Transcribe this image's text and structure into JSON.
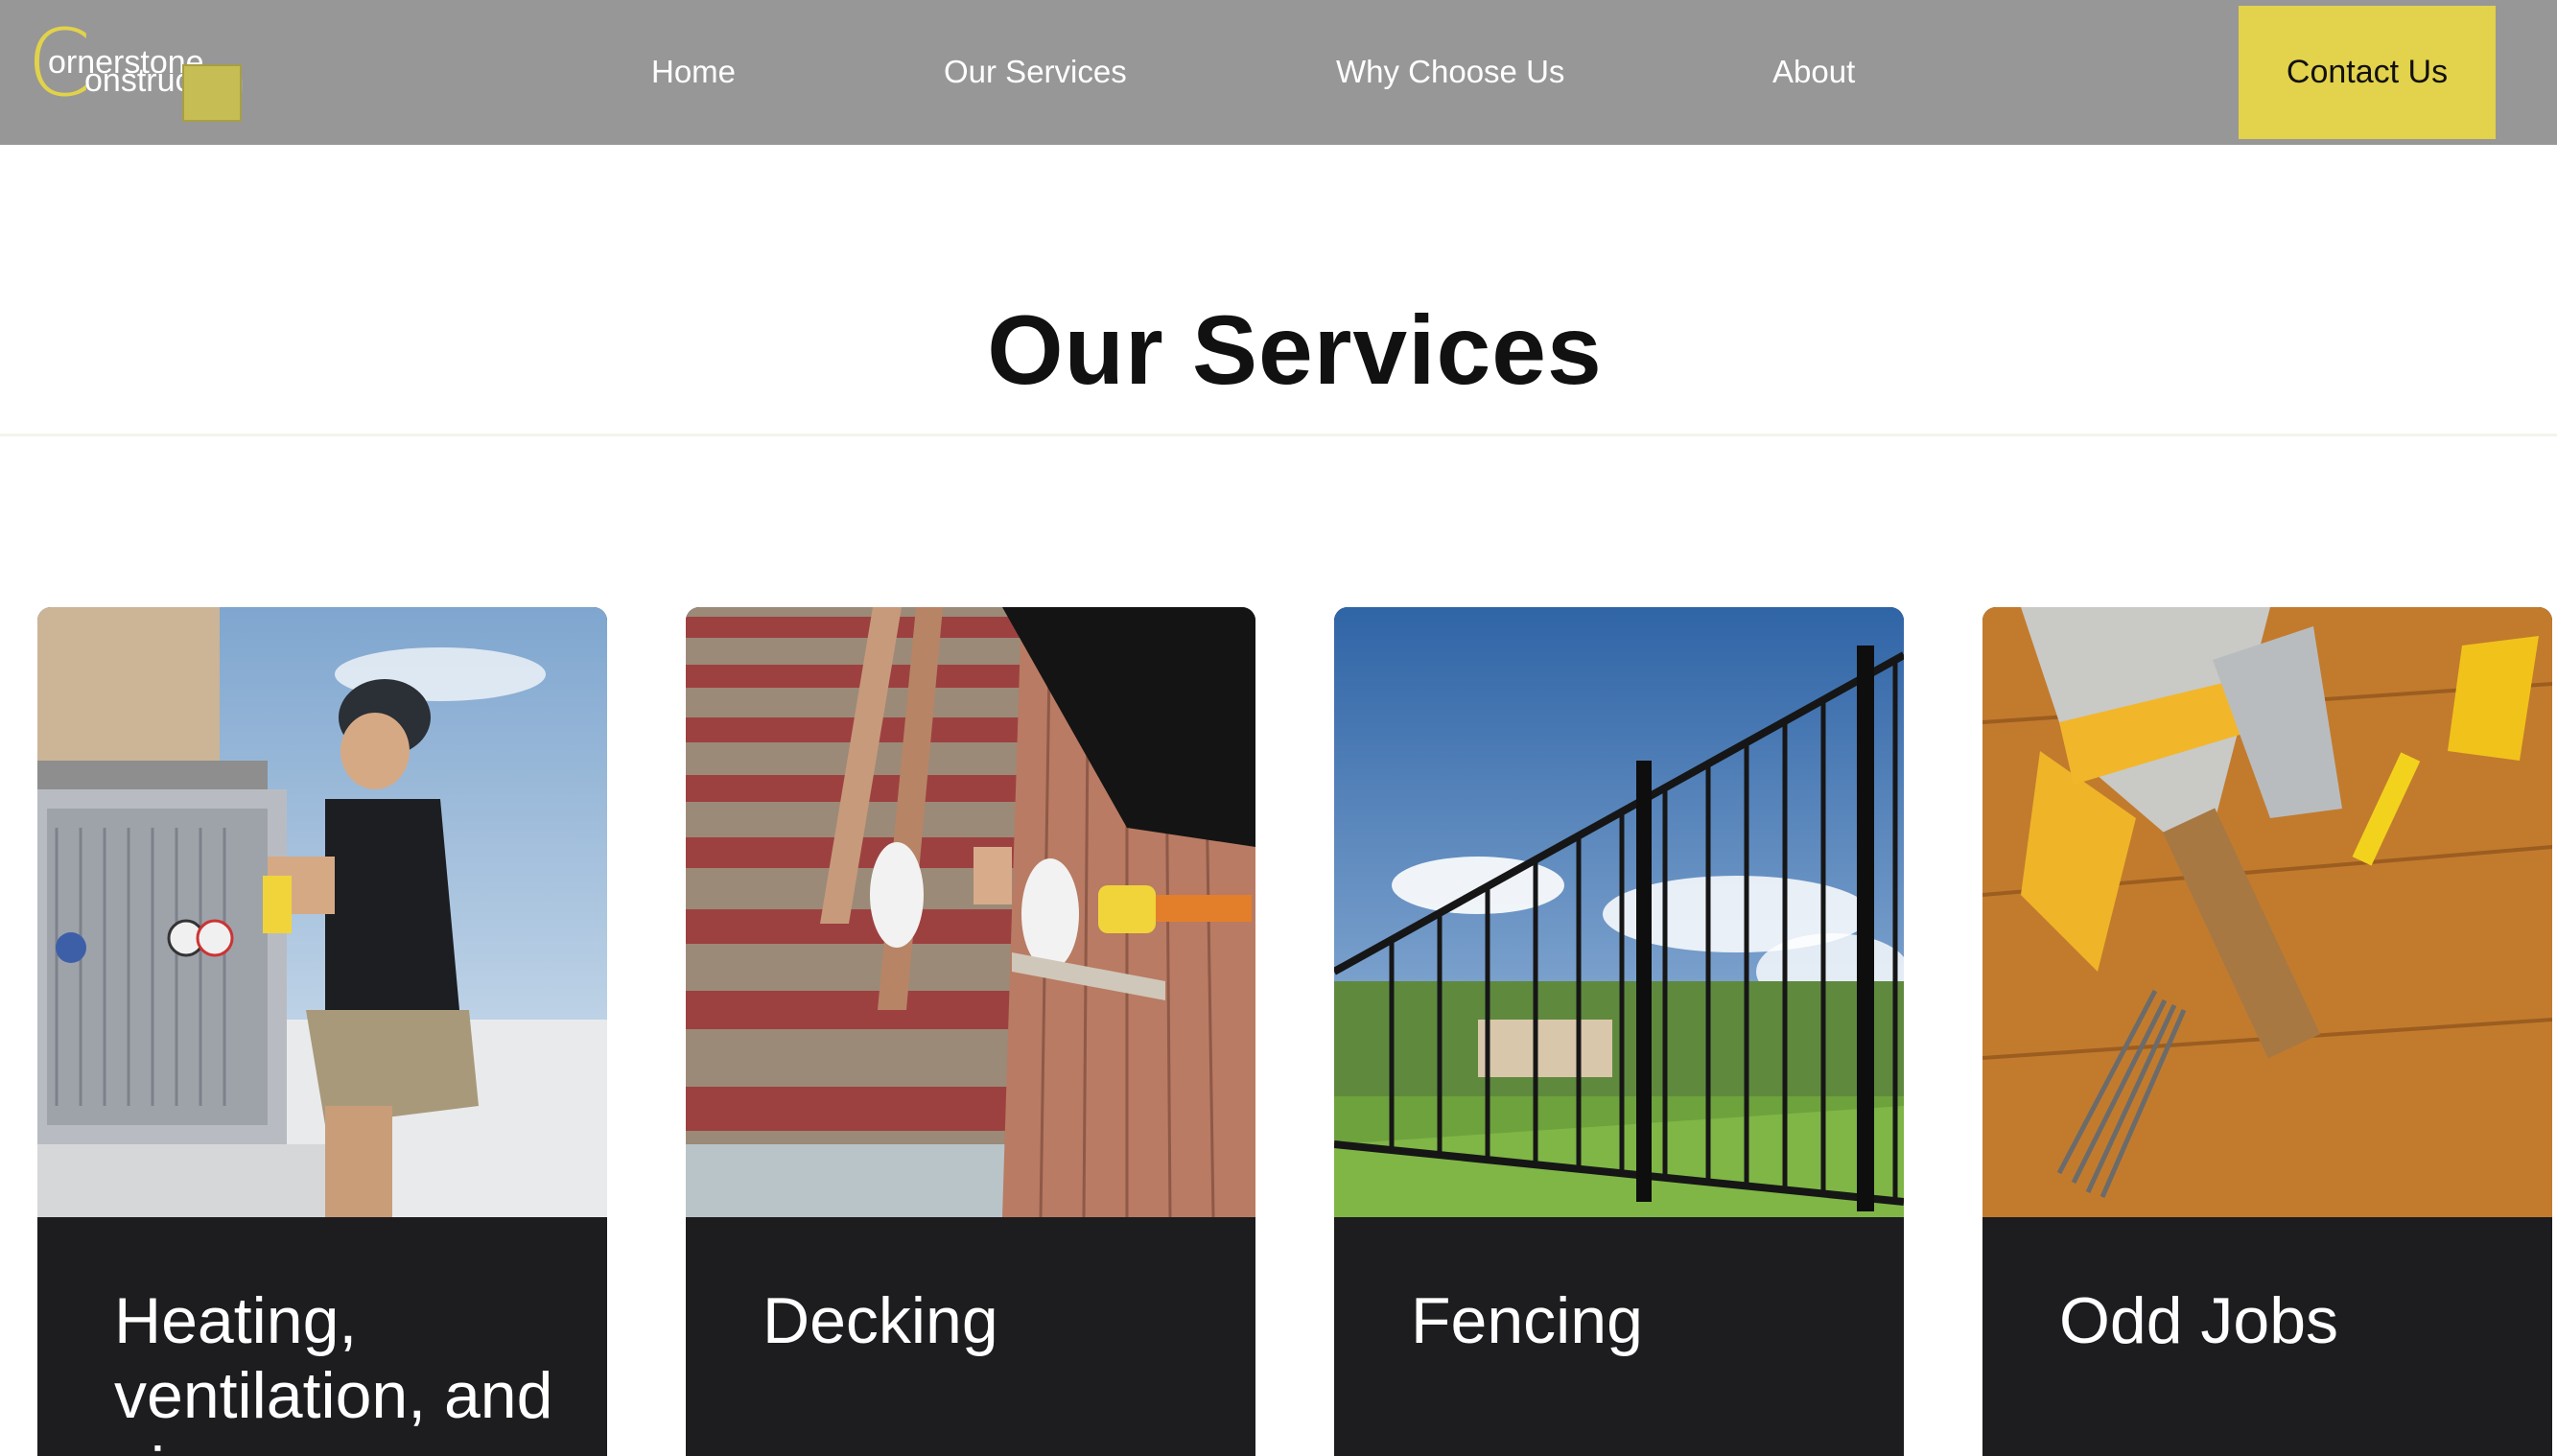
{
  "brand": {
    "logo_letter": "C",
    "line1": "ornerstone",
    "line2": "onstruction",
    "accent": "#e3d24b"
  },
  "nav": {
    "items": [
      "Home",
      "Our Services",
      "Why Choose Us",
      "About"
    ],
    "contact_label": "Contact Us"
  },
  "section": {
    "title": "Our Services"
  },
  "cards": [
    {
      "title": "Heating, ventilation, and air",
      "image": "hvac-technician-photo"
    },
    {
      "title": "Decking",
      "image": "decking-installation-photo"
    },
    {
      "title": "Fencing",
      "image": "metal-fence-photo"
    },
    {
      "title": "Odd Jobs",
      "image": "hand-tools-photo"
    }
  ]
}
